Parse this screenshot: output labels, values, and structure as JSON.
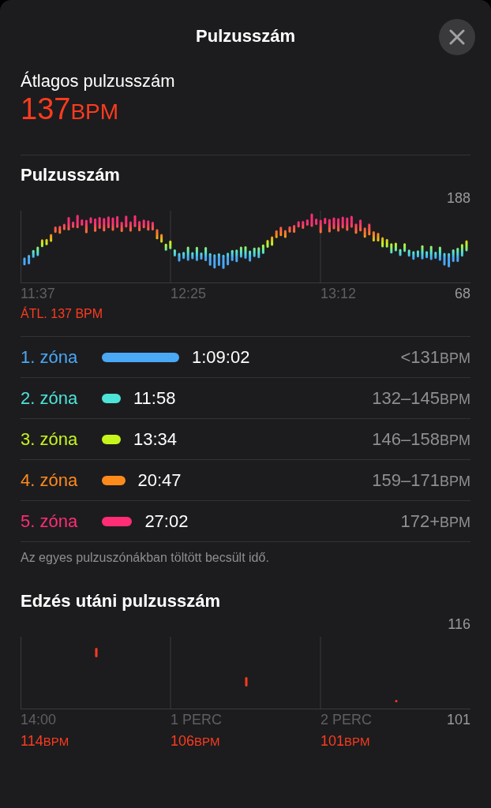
{
  "header": {
    "title": "Pulzusszám"
  },
  "average": {
    "label": "Átlagos pulzusszám",
    "value": "137",
    "unit": "BPM"
  },
  "heart_rate": {
    "title": "Pulzusszám",
    "y_max": "188",
    "y_min": "68",
    "x_labels": [
      "11:37",
      "12:25",
      "13:12"
    ],
    "average_label": "ÁTL. 137 BPM"
  },
  "zones": [
    {
      "name": "1. zóna",
      "color": "#4aa8f5",
      "duration": "1:09:02",
      "range": "<131",
      "unit": "BPM"
    },
    {
      "name": "2. zóna",
      "color": "#4ee3d8",
      "duration": "11:58",
      "range": "132–145",
      "unit": "BPM"
    },
    {
      "name": "3. zóna",
      "color": "#c6f51c",
      "duration": "13:34",
      "range": "146–158",
      "unit": "BPM"
    },
    {
      "name": "4. zóna",
      "color": "#ff8a1c",
      "duration": "20:47",
      "range": "159–171",
      "unit": "BPM"
    },
    {
      "name": "5. zóna",
      "color": "#ff2d75",
      "duration": "27:02",
      "range": "172+",
      "unit": "BPM"
    }
  ],
  "zones_note": "Az egyes pulzuszónákban töltött becsült idő.",
  "recovery": {
    "title": "Edzés utáni pulzusszám",
    "y_max": "116",
    "y_min": "101",
    "x_labels": [
      "14:00",
      "1 PERC",
      "2 PERC"
    ],
    "readings": [
      {
        "value": "114",
        "unit": "BPM"
      },
      {
        "value": "106",
        "unit": "BPM"
      },
      {
        "value": "101",
        "unit": "BPM"
      }
    ]
  }
}
